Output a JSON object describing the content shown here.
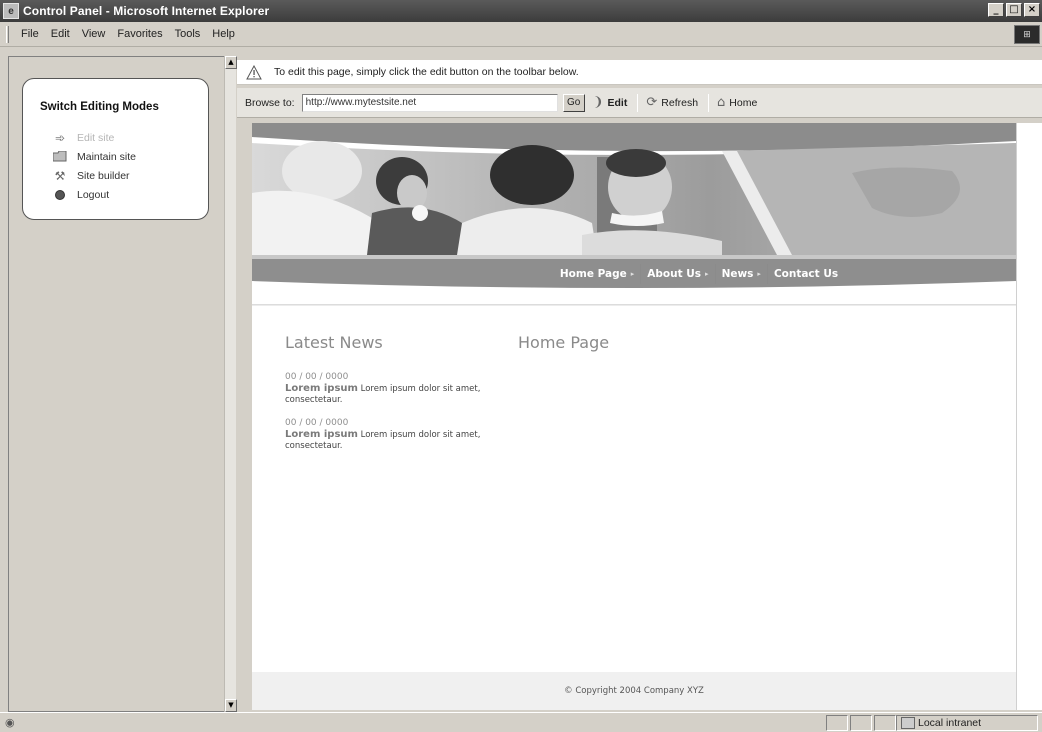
{
  "window": {
    "title": "Control Panel - Microsoft Internet Explorer",
    "controls": {
      "minimize": "_",
      "maximize": "□",
      "close": "×"
    }
  },
  "menu": {
    "items": [
      {
        "label": "File"
      },
      {
        "label": "Edit"
      },
      {
        "label": "View"
      },
      {
        "label": "Favorites"
      },
      {
        "label": "Tools"
      },
      {
        "label": "Help"
      }
    ]
  },
  "left_panel": {
    "heading": "Switch Editing Modes",
    "modes": [
      {
        "label": "Edit site",
        "icon": "edit-arrow-icon",
        "disabled": true
      },
      {
        "label": "Maintain site",
        "icon": "folder-icon",
        "disabled": false
      },
      {
        "label": "Site builder",
        "icon": "tools-icon",
        "disabled": false
      },
      {
        "label": "Logout",
        "icon": "logout-icon",
        "disabled": false
      }
    ]
  },
  "infobar": {
    "text": "To edit this page, simply click the edit button on the toolbar below.",
    "icon": "warning-icon"
  },
  "browsebar": {
    "label": "Browse to:",
    "url": "http://www.mytestsite.net",
    "go": "Go",
    "edit": "Edit",
    "refresh": "Refresh",
    "home": "Home"
  },
  "site": {
    "nav": [
      {
        "label": "Home Page"
      },
      {
        "label": "About Us"
      },
      {
        "label": "News"
      },
      {
        "label": "Contact Us"
      }
    ],
    "latest_news": {
      "title": "Latest News",
      "items": [
        {
          "date": "00 / 00 / 0000",
          "head": "Lorem ipsum",
          "body": "Lorem ipsum dolor sit amet, consectetaur."
        },
        {
          "date": "00 / 00 / 0000",
          "head": "Lorem ipsum",
          "body": "Lorem ipsum dolor sit amet, consectetaur."
        }
      ]
    },
    "main_title": "Home Page",
    "footer": "© Copyright 2004 Company XYZ"
  },
  "status": {
    "zone": "Local intranet"
  }
}
